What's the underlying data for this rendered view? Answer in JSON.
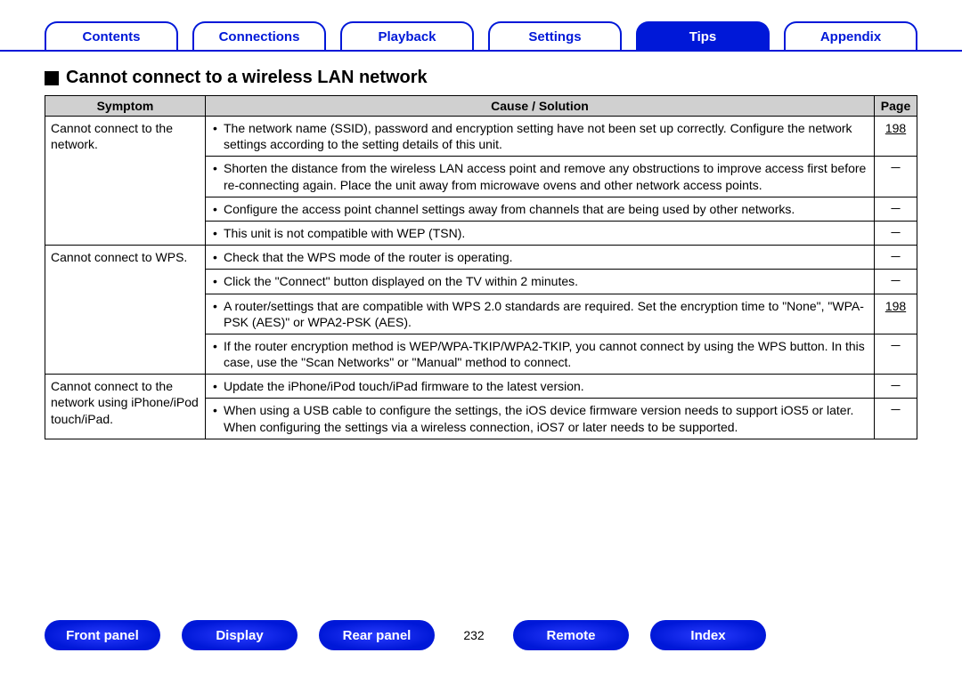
{
  "top_tabs": {
    "contents": "Contents",
    "connections": "Connections",
    "playback": "Playback",
    "settings": "Settings",
    "tips": "Tips",
    "appendix": "Appendix"
  },
  "heading": "Cannot connect to a wireless LAN network",
  "columns": {
    "symptom": "Symptom",
    "cause": "Cause / Solution",
    "page": "Page"
  },
  "groups": [
    {
      "symptom": "Cannot connect to the network.",
      "rows": [
        {
          "cause": "The network name (SSID), password and encryption setting have not been set up correctly. Configure the network settings according to the setting details of this unit.",
          "page": "198",
          "link": true
        },
        {
          "cause": "Shorten the distance from the wireless LAN access point and remove any obstructions to improve access first before re-connecting again. Place the unit away from microwave ovens and other network access points.",
          "page": "－",
          "link": false
        },
        {
          "cause": "Configure the access point channel settings away from channels that are being used by other networks.",
          "page": "－",
          "link": false
        },
        {
          "cause": "This unit is not compatible with WEP (TSN).",
          "page": "－",
          "link": false
        }
      ]
    },
    {
      "symptom": "Cannot connect to WPS.",
      "rows": [
        {
          "cause": "Check that the WPS mode of the router is operating.",
          "page": "－",
          "link": false
        },
        {
          "cause": "Click the \"Connect\" button displayed on the TV within 2 minutes.",
          "page": "－",
          "link": false
        },
        {
          "cause": "A router/settings that are compatible with WPS 2.0 standards are required. Set the encryption time to \"None\", \"WPA-PSK (AES)\" or WPA2-PSK (AES).",
          "page": "198",
          "link": true
        },
        {
          "cause": "If the router encryption method is WEP/WPA-TKIP/WPA2-TKIP, you cannot connect by using the WPS button. In this case, use the \"Scan Networks\" or \"Manual\" method to connect.",
          "page": "－",
          "link": false
        }
      ]
    },
    {
      "symptom": "Cannot connect to the network using iPhone/iPod touch/iPad.",
      "rows": [
        {
          "cause": "Update the iPhone/iPod touch/iPad firmware to the latest version.",
          "page": "－",
          "link": false
        },
        {
          "cause": "When using a USB cable to configure the settings, the iOS device firmware version needs to support iOS5 or later. When configuring the settings via a wireless connection, iOS7 or later needs to be supported.",
          "page": "－",
          "link": false
        }
      ]
    }
  ],
  "bottom": {
    "front_panel": "Front panel",
    "display": "Display",
    "rear_panel": "Rear panel",
    "remote": "Remote",
    "index": "Index",
    "page_number": "232"
  }
}
